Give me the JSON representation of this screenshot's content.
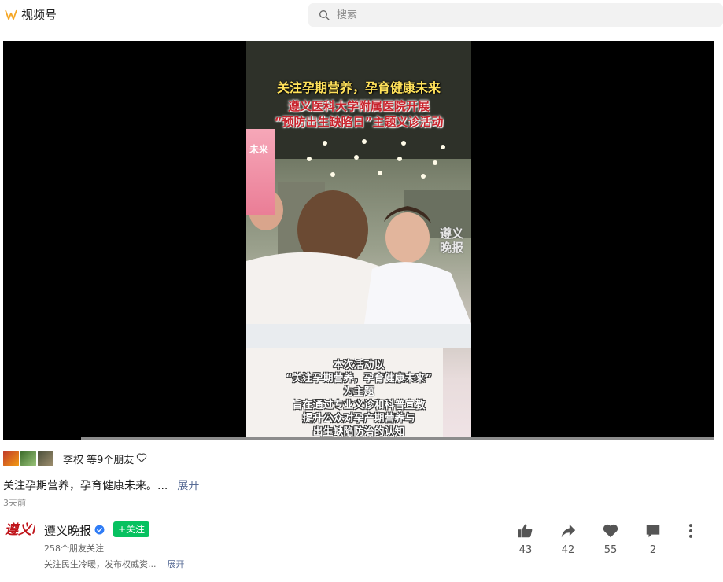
{
  "header": {
    "app_name": "视频号",
    "search_placeholder": "搜索"
  },
  "video": {
    "title_line1": "关注孕期营养，孕育健康未来",
    "title_line2": "遵义医科大学附属医院开展",
    "title_line3": "“预防出生缺陷日”主题义诊活动",
    "banner_text": "未来",
    "watermark": "遵义晚报",
    "subtitle_lines": [
      "本次活动以",
      "“关注孕期营养，孕育健康未来”",
      "为主题",
      "旨在通过专业义诊和科普宣教",
      "提升公众对孕产期营养与",
      "出生缺陷防治的认知"
    ],
    "progress": 0.11
  },
  "friends": {
    "names": "李权 等9个朋友"
  },
  "description": {
    "text": "关注孕期营养，孕育健康未来。...",
    "more_label": "展开",
    "time": "3天前"
  },
  "author": {
    "name": "遵义晚报",
    "follow_label": "+关注",
    "fans": "258个朋友关注",
    "bio": "关注民生冷暖，发布权威资...",
    "bio_more": "展开",
    "logo_text": "遵义晚报"
  },
  "actions": {
    "like_count": "43",
    "share_count": "42",
    "favorite_count": "55",
    "comment_count": "2"
  },
  "colors": {
    "follow_green": "#07c160",
    "link_blue": "#576b95",
    "brand_orange": "#f5a623"
  }
}
